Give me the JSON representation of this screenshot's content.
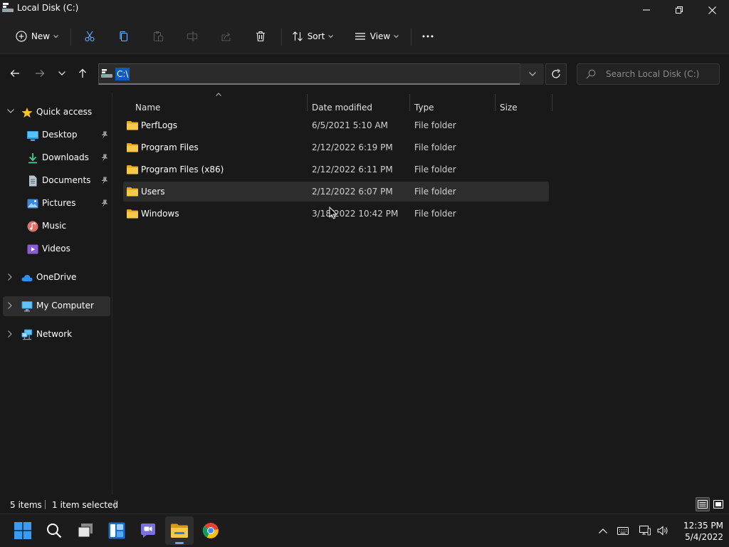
{
  "window": {
    "title": "Local Disk (C:)",
    "icon": "drive-icon",
    "controls": [
      "minimize",
      "restore",
      "close"
    ]
  },
  "toolbar": {
    "new_label": "New",
    "sort_label": "Sort",
    "view_label": "View",
    "buttons": [
      "cut-icon",
      "copy-icon",
      "paste-icon",
      "rename-icon",
      "share-icon",
      "delete-icon",
      "more-icon"
    ]
  },
  "nav": {
    "address": "C:\\",
    "search_placeholder": "Search Local Disk (C:)"
  },
  "sidebar": {
    "quick_access": "Quick access",
    "items": [
      {
        "label": "Desktop",
        "icon": "desktop-icon",
        "pinned": true
      },
      {
        "label": "Downloads",
        "icon": "download-icon",
        "pinned": true
      },
      {
        "label": "Documents",
        "icon": "document-icon",
        "pinned": true
      },
      {
        "label": "Pictures",
        "icon": "pictures-icon",
        "pinned": true
      },
      {
        "label": "Music",
        "icon": "music-icon",
        "pinned": false
      },
      {
        "label": "Videos",
        "icon": "videos-icon",
        "pinned": false
      }
    ],
    "onedrive": "OneDrive",
    "computer": "My Computer",
    "network": "Network",
    "selected": "My Computer"
  },
  "columns": {
    "name": "Name",
    "date": "Date modified",
    "type": "Type",
    "size": "Size"
  },
  "files": [
    {
      "name": "PerfLogs",
      "date": "6/5/2021 5:10 AM",
      "type": "File folder",
      "size": ""
    },
    {
      "name": "Program Files",
      "date": "2/12/2022 6:19 PM",
      "type": "File folder",
      "size": ""
    },
    {
      "name": "Program Files (x86)",
      "date": "2/12/2022 6:11 PM",
      "type": "File folder",
      "size": ""
    },
    {
      "name": "Users",
      "date": "2/12/2022 6:07 PM",
      "type": "File folder",
      "size": ""
    },
    {
      "name": "Windows",
      "date": "3/18/2022 10:42 PM",
      "type": "File folder",
      "size": ""
    }
  ],
  "status": {
    "items": "5 items",
    "selected": "1 item selected"
  },
  "taskbar": {
    "apps": [
      "windows-start-icon",
      "search-icon",
      "task-view-icon",
      "widgets-icon",
      "teams-chat-icon",
      "file-explorer-icon",
      "chrome-icon"
    ],
    "active_app": "file-explorer-icon",
    "time": "12:35 PM",
    "date": "5/4/2022"
  },
  "colors": {
    "background": "#191919",
    "chrome": "#202020",
    "accent": "#0a5cbf",
    "folder": "#f4c24d"
  }
}
